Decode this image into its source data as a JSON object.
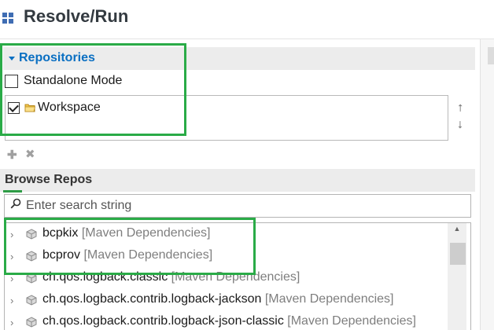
{
  "header": {
    "title": "Resolve/Run",
    "icon": "grid-icon"
  },
  "repositories": {
    "section_label": "Repositories",
    "standalone_label": "Standalone Mode",
    "standalone_checked": false,
    "items": [
      {
        "label": "Workspace",
        "checked": true,
        "icon": "folder-icon"
      }
    ],
    "move_up_symbol": "⭡",
    "move_down_symbol": "⭣",
    "add_symbol": "✚",
    "remove_symbol": "✖"
  },
  "browse": {
    "section_label": "Browse Repos",
    "search_placeholder": "Enter search string",
    "tree": [
      {
        "name": "bcpkix",
        "source": "[Maven Dependencies]"
      },
      {
        "name": "bcprov",
        "source": "[Maven Dependencies]"
      },
      {
        "name": "ch.qos.logback.classic",
        "source": "[Maven Dependencies]"
      },
      {
        "name": "ch.qos.logback.contrib.logback-jackson",
        "source": "[Maven Dependencies]"
      },
      {
        "name": "ch.qos.logback.contrib.logback-json-classic",
        "source": "[Maven Dependencies]"
      }
    ]
  },
  "colors": {
    "accent": "#0a6fc2",
    "highlight": "#2aab47"
  }
}
